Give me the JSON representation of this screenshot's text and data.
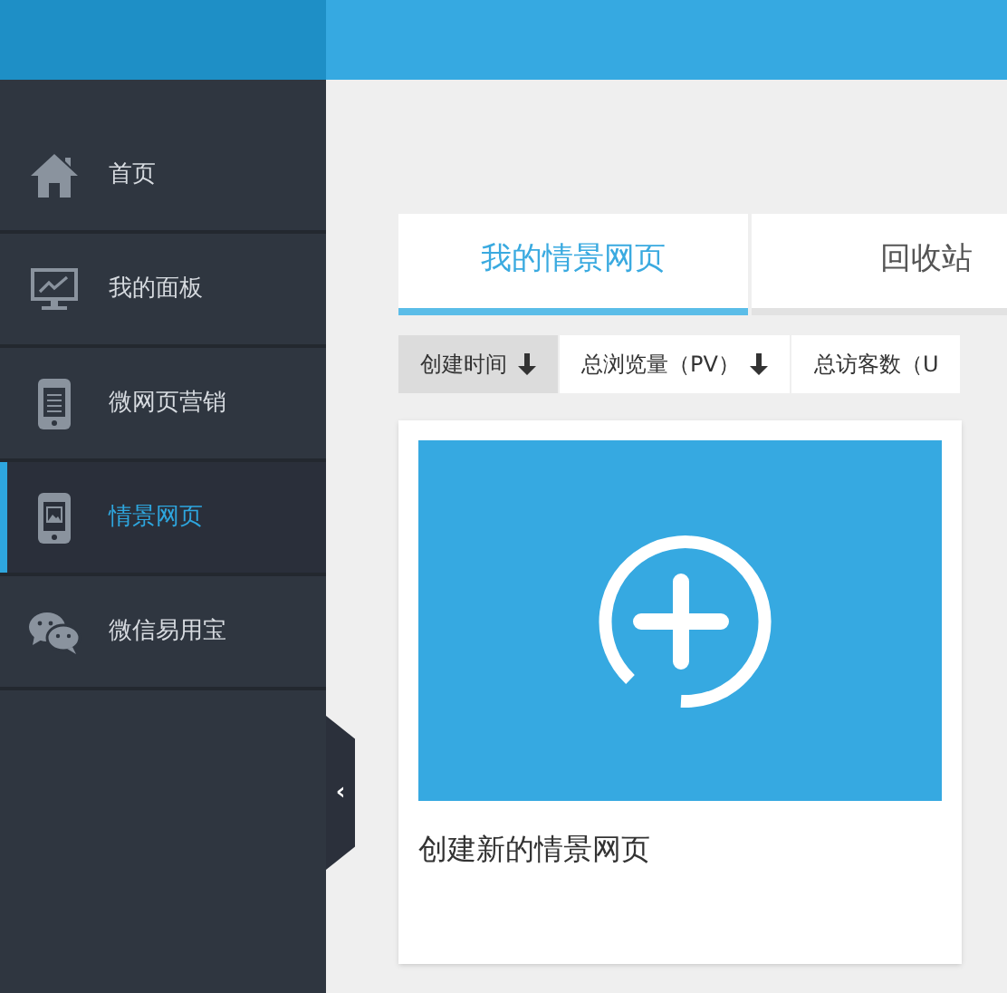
{
  "sidebar": {
    "items": [
      {
        "kind": "home",
        "label": "首页",
        "selected": false
      },
      {
        "kind": "monitor",
        "label": "我的面板",
        "selected": false
      },
      {
        "kind": "phone-list",
        "label": "微网页营销",
        "selected": false
      },
      {
        "kind": "phone-image",
        "label": "情景网页",
        "selected": true
      },
      {
        "kind": "chat",
        "label": "微信易用宝",
        "selected": false
      }
    ]
  },
  "collapse_button": "‹",
  "tabs": [
    {
      "label": "我的情景网页",
      "selected": true
    },
    {
      "label": "回收站",
      "selected": false
    }
  ],
  "sort_options": [
    {
      "label": "创建时间",
      "selected": true,
      "sorted": true
    },
    {
      "label": "总浏览量（PV）",
      "selected": false,
      "sorted": true
    },
    {
      "label": "总访客数（U",
      "selected": false,
      "sorted": false
    }
  ],
  "new_page_card": {
    "caption": "创建新的情景网页"
  }
}
